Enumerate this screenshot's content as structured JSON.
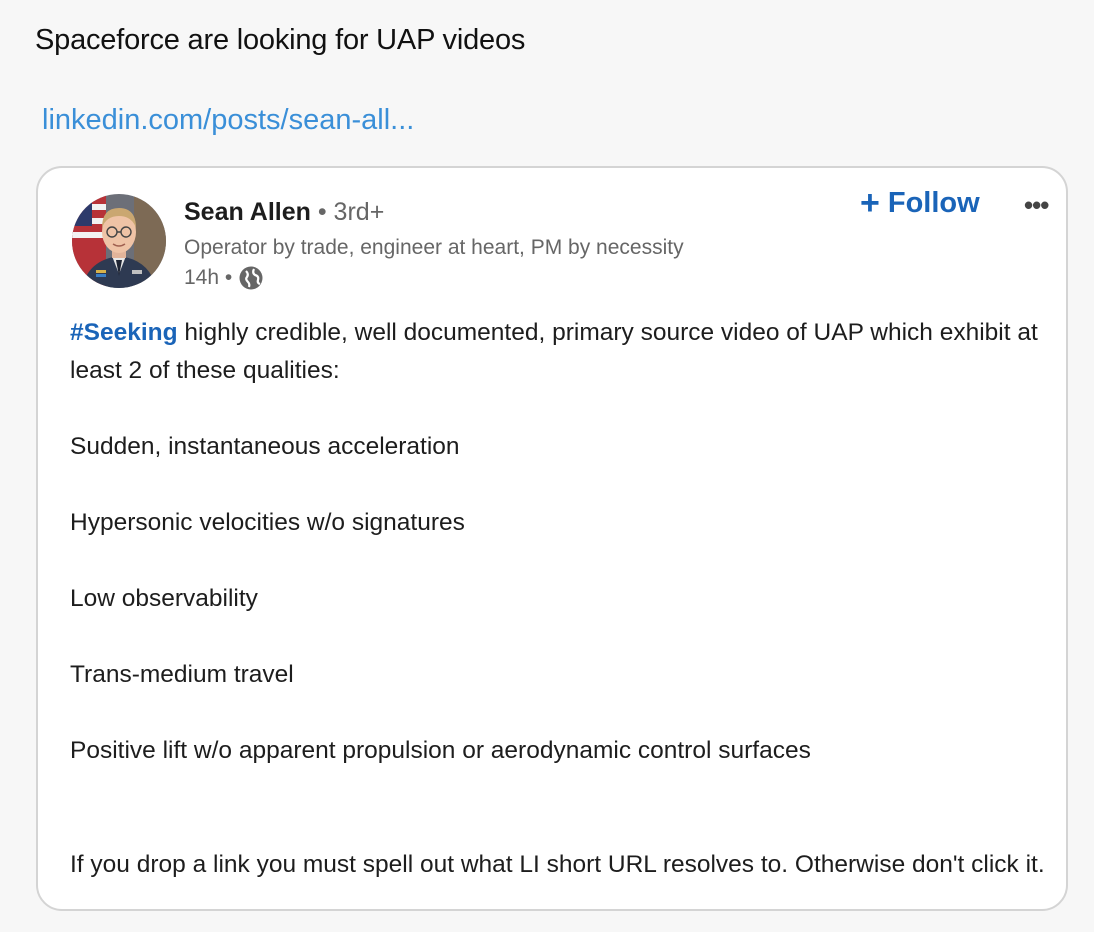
{
  "tweet": {
    "text": "Spaceforce are looking for UAP videos",
    "link": "linkedin.com/posts/sean-all..."
  },
  "post": {
    "author": "Sean Allen",
    "degree": "• 3rd+",
    "headline": "Operator by trade, engineer at heart, PM by necessity",
    "time": "14h •",
    "follow_label": "Follow",
    "more_label": "•••",
    "hashtag": "#Seeking",
    "intro": " highly credible, well documented, primary source video of UAP which exhibit at least 2 of these qualities:",
    "qualities": [
      "Sudden, instantaneous acceleration",
      "Hypersonic velocities w/o signatures",
      "Low observability",
      "Trans-medium travel",
      "Positive lift w/o apparent propulsion or aerodynamic control surfaces"
    ],
    "closing": "If you drop a link you must spell out what LI short URL resolves to. Otherwise don't click it."
  },
  "colors": {
    "link": "#3a8fd8",
    "linkedin_blue": "#1a64b8",
    "background": "#f7f7f7"
  },
  "icons": [
    "globe-icon",
    "plus-icon",
    "more-icon"
  ]
}
